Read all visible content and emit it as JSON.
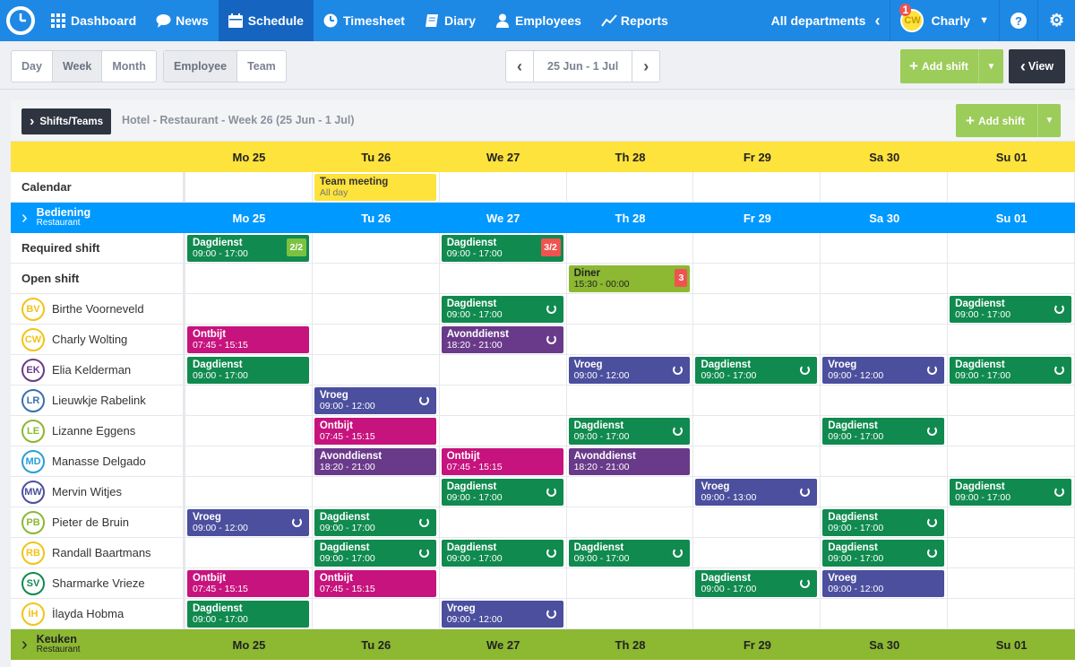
{
  "nav": {
    "items": [
      {
        "label": "Dashboard",
        "icon": "grid-icon"
      },
      {
        "label": "News",
        "icon": "chat-icon"
      },
      {
        "label": "Schedule",
        "icon": "calendar-icon",
        "active": true
      },
      {
        "label": "Timesheet",
        "icon": "clock-icon"
      },
      {
        "label": "Diary",
        "icon": "book-icon"
      },
      {
        "label": "Employees",
        "icon": "person-icon"
      },
      {
        "label": "Reports",
        "icon": "chart-icon"
      }
    ],
    "department": "All departments",
    "user": {
      "initials": "CW",
      "name": "Charly",
      "notifications": "1"
    }
  },
  "toolbar": {
    "views": [
      "Day",
      "Week",
      "Month"
    ],
    "selected_view": "Week",
    "groupings": [
      "Employee",
      "Team"
    ],
    "date_range": "25 Jun - 1 Jul",
    "add_shift_label": "Add shift",
    "view_label": "View"
  },
  "card": {
    "toggle_label": "Shifts/Teams",
    "title": "Hotel - Restaurant - Week 26 (25 Jun - 1 Jul)",
    "add_shift_label": "Add shift"
  },
  "days": [
    "Mo 25",
    "Tu 26",
    "We 27",
    "Th 28",
    "Fr 29",
    "Sa 30",
    "Su 01"
  ],
  "calendar": {
    "label": "Calendar",
    "event": {
      "title": "Team meeting",
      "sub": "All day",
      "day": 1
    }
  },
  "teams": [
    {
      "name": "Bediening",
      "sub": "Restaurant",
      "color": "#0099ff"
    },
    {
      "name": "Keuken",
      "sub": "Restaurant",
      "color": "#8cb832"
    }
  ],
  "required_shift": {
    "label": "Required shift",
    "shifts": [
      {
        "day": 0,
        "title": "Dagdienst",
        "time": "09:00 - 17:00",
        "badge": "2/2",
        "badge_color": "#7cc242"
      },
      {
        "day": 2,
        "title": "Dagdienst",
        "time": "09:00 - 17:00",
        "badge": "3/2",
        "badge_color": "#ef5350"
      }
    ]
  },
  "open_shift": {
    "label": "Open shift",
    "shifts": [
      {
        "day": 3,
        "title": "Diner",
        "time": "15:30 - 00:00",
        "badge": "3",
        "badge_color": "#ef5350"
      }
    ]
  },
  "employees": [
    {
      "initials": "BV",
      "name": "Birthe Voorneveld",
      "avatar_color": "#f0c419",
      "shifts": [
        {
          "day": 2,
          "title": "Dagdienst",
          "time": "09:00 - 17:00",
          "color": "green",
          "repeat": true
        },
        {
          "day": 6,
          "title": "Dagdienst",
          "time": "09:00 - 17:00",
          "color": "green",
          "repeat": true
        }
      ]
    },
    {
      "initials": "CW",
      "name": "Charly Wolting",
      "avatar_color": "#f0c419",
      "shifts": [
        {
          "day": 0,
          "title": "Ontbijt",
          "time": "07:45 - 15:15",
          "color": "pink",
          "repeat": false
        },
        {
          "day": 2,
          "title": "Avonddienst",
          "time": "18:20 - 21:00",
          "color": "purple",
          "repeat": true
        }
      ]
    },
    {
      "initials": "EK",
      "name": "Elia Kelderman",
      "avatar_color": "#6a3a8a",
      "shifts": [
        {
          "day": 0,
          "title": "Dagdienst",
          "time": "09:00 - 17:00",
          "color": "green",
          "repeat": false
        },
        {
          "day": 3,
          "title": "Vroeg",
          "time": "09:00 - 12:00",
          "color": "indigo",
          "repeat": true
        },
        {
          "day": 4,
          "title": "Dagdienst",
          "time": "09:00 - 17:00",
          "color": "green",
          "repeat": true
        },
        {
          "day": 5,
          "title": "Vroeg",
          "time": "09:00 - 12:00",
          "color": "indigo",
          "repeat": true
        },
        {
          "day": 6,
          "title": "Dagdienst",
          "time": "09:00 - 17:00",
          "color": "green",
          "repeat": true
        }
      ]
    },
    {
      "initials": "LR",
      "name": "Lieuwkje Rabelink",
      "avatar_color": "#3a6fb0",
      "shifts": [
        {
          "day": 1,
          "title": "Vroeg",
          "time": "09:00 - 12:00",
          "color": "indigo",
          "repeat": true
        }
      ]
    },
    {
      "initials": "LE",
      "name": "Lizanne Eggens",
      "avatar_color": "#8cb832",
      "shifts": [
        {
          "day": 1,
          "title": "Ontbijt",
          "time": "07:45 - 15:15",
          "color": "pink",
          "repeat": false
        },
        {
          "day": 3,
          "title": "Dagdienst",
          "time": "09:00 - 17:00",
          "color": "green",
          "repeat": true
        },
        {
          "day": 5,
          "title": "Dagdienst",
          "time": "09:00 - 17:00",
          "color": "green",
          "repeat": true
        }
      ]
    },
    {
      "initials": "MD",
      "name": "Manasse Delgado",
      "avatar_color": "#2a9fd6",
      "shifts": [
        {
          "day": 1,
          "title": "Avonddienst",
          "time": "18:20 - 21:00",
          "color": "purple",
          "repeat": false
        },
        {
          "day": 2,
          "title": "Ontbijt",
          "time": "07:45 - 15:15",
          "color": "pink",
          "repeat": false
        },
        {
          "day": 3,
          "title": "Avonddienst",
          "time": "18:20 - 21:00",
          "color": "purple",
          "repeat": false
        }
      ]
    },
    {
      "initials": "MW",
      "name": "Mervin Witjes",
      "avatar_color": "#4b4f9e",
      "shifts": [
        {
          "day": 2,
          "title": "Dagdienst",
          "time": "09:00 - 17:00",
          "color": "green",
          "repeat": true
        },
        {
          "day": 4,
          "title": "Vroeg",
          "time": "09:00 - 13:00",
          "color": "indigo",
          "repeat": true
        },
        {
          "day": 6,
          "title": "Dagdienst",
          "time": "09:00 - 17:00",
          "color": "green",
          "repeat": true
        }
      ]
    },
    {
      "initials": "PB",
      "name": "Pieter de Bruin",
      "avatar_color": "#8cb832",
      "shifts": [
        {
          "day": 0,
          "title": "Vroeg",
          "time": "09:00 - 12:00",
          "color": "indigo",
          "repeat": true
        },
        {
          "day": 1,
          "title": "Dagdienst",
          "time": "09:00 - 17:00",
          "color": "green",
          "repeat": true
        },
        {
          "day": 5,
          "title": "Dagdienst",
          "time": "09:00 - 17:00",
          "color": "green",
          "repeat": true
        }
      ]
    },
    {
      "initials": "RB",
      "name": "Randall Baartmans",
      "avatar_color": "#f0c419",
      "shifts": [
        {
          "day": 1,
          "title": "Dagdienst",
          "time": "09:00 - 17:00",
          "color": "green",
          "repeat": true
        },
        {
          "day": 2,
          "title": "Dagdienst",
          "time": "09:00 - 17:00",
          "color": "green",
          "repeat": true
        },
        {
          "day": 3,
          "title": "Dagdienst",
          "time": "09:00 - 17:00",
          "color": "green",
          "repeat": true
        },
        {
          "day": 5,
          "title": "Dagdienst",
          "time": "09:00 - 17:00",
          "color": "green",
          "repeat": true
        }
      ]
    },
    {
      "initials": "SV",
      "name": "Sharmarke Vrieze",
      "avatar_color": "#108a4f",
      "shifts": [
        {
          "day": 0,
          "title": "Ontbijt",
          "time": "07:45 - 15:15",
          "color": "pink",
          "repeat": false
        },
        {
          "day": 1,
          "title": "Ontbijt",
          "time": "07:45 - 15:15",
          "color": "pink",
          "repeat": false
        },
        {
          "day": 4,
          "title": "Dagdienst",
          "time": "09:00 - 17:00",
          "color": "green",
          "repeat": true
        },
        {
          "day": 5,
          "title": "Vroeg",
          "time": "09:00 - 12:00",
          "color": "indigo",
          "repeat": false
        }
      ]
    },
    {
      "initials": "İH",
      "name": "İlayda Hobma",
      "avatar_color": "#f0c419",
      "shifts": [
        {
          "day": 0,
          "title": "Dagdienst",
          "time": "09:00 - 17:00",
          "color": "green",
          "repeat": false
        },
        {
          "day": 2,
          "title": "Vroeg",
          "time": "09:00 - 12:00",
          "color": "indigo",
          "repeat": true
        }
      ]
    }
  ]
}
